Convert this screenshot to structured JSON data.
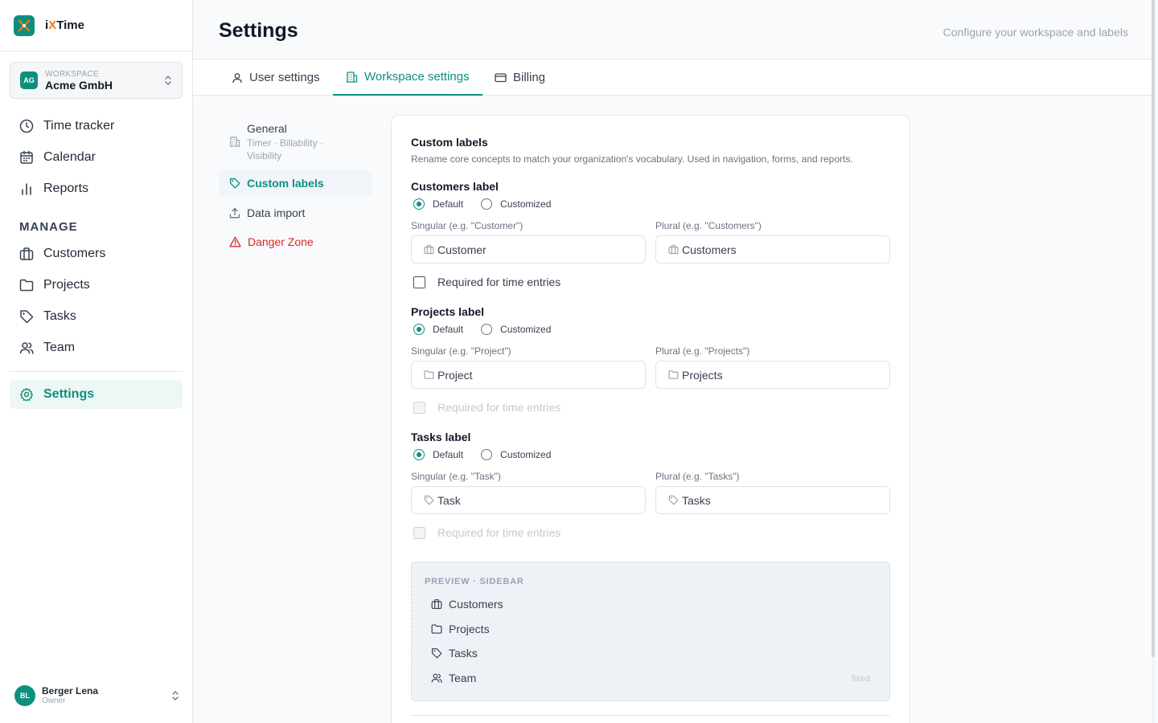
{
  "app": {
    "name_prefix": "i",
    "name_x": "X",
    "name_suffix": "Time"
  },
  "workspace": {
    "initials": "AG",
    "caption": "WORKSPACE",
    "name": "Acme GmbH"
  },
  "nav": {
    "time_tracker": "Time tracker",
    "calendar": "Calendar",
    "reports": "Reports",
    "manage_heading": "MANAGE",
    "customers": "Customers",
    "projects": "Projects",
    "tasks": "Tasks",
    "team": "Team",
    "settings": "Settings"
  },
  "user": {
    "initials": "BL",
    "name": "Berger Lena",
    "role": "Owner"
  },
  "header": {
    "title": "Settings",
    "subtitle": "Configure your workspace and labels"
  },
  "tabs": {
    "user": "User settings",
    "workspace": "Workspace settings",
    "billing": "Billing"
  },
  "subnav": {
    "general": "General",
    "general_desc": "Timer · Billability · Visibility",
    "custom_labels": "Custom labels",
    "data_import": "Data import",
    "danger_zone": "Danger Zone"
  },
  "card": {
    "title": "Custom labels",
    "description": "Rename core concepts to match your organization's vocabulary. Used in navigation, forms, and reports.",
    "radio_default": "Default",
    "radio_customized": "Customized",
    "required_label": "Required for time entries",
    "groups": {
      "customers": {
        "title": "Customers label",
        "singular_label": "Singular (e.g. \"Customer\")",
        "plural_label": "Plural (e.g. \"Customers\")",
        "singular_value": "Customer",
        "plural_value": "Customers",
        "selected": "Default",
        "required_enabled": true,
        "required_checked": false
      },
      "projects": {
        "title": "Projects label",
        "singular_label": "Singular (e.g. \"Project\")",
        "plural_label": "Plural (e.g. \"Projects\")",
        "singular_value": "Project",
        "plural_value": "Projects",
        "selected": "Default",
        "required_enabled": false,
        "required_checked": false
      },
      "tasks": {
        "title": "Tasks label",
        "singular_label": "Singular (e.g. \"Task\")",
        "plural_label": "Plural (e.g. \"Tasks\")",
        "singular_value": "Task",
        "plural_value": "Tasks",
        "selected": "Default",
        "required_enabled": false,
        "required_checked": false
      }
    },
    "preview": {
      "title": "PREVIEW · SIDEBAR",
      "items": [
        "Customers",
        "Projects",
        "Tasks",
        "Team"
      ],
      "fixed_note": "fixed"
    }
  },
  "colors": {
    "accent": "#0e8f7e",
    "brand_x": "#f97316",
    "danger": "#dc2626"
  }
}
